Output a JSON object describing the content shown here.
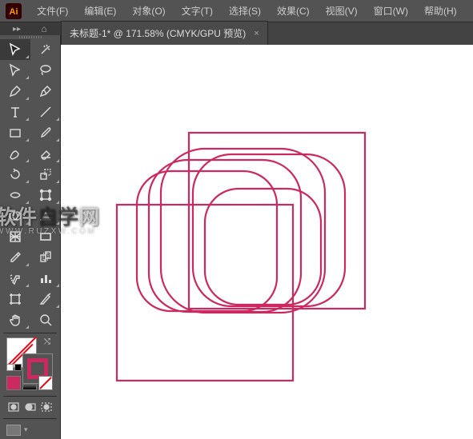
{
  "app": {
    "name": "Adobe Illustrator",
    "logo_bg": "#330000",
    "logo_fg": "#ff9a00"
  },
  "menu": [
    {
      "label": "文件(F)"
    },
    {
      "label": "编辑(E)"
    },
    {
      "label": "对象(O)"
    },
    {
      "label": "文字(T)"
    },
    {
      "label": "选择(S)"
    },
    {
      "label": "效果(C)"
    },
    {
      "label": "视图(V)"
    },
    {
      "label": "窗口(W)"
    },
    {
      "label": "帮助(H)"
    }
  ],
  "document": {
    "tab_label": "未标题-1* @ 171.58% (CMYK/GPU 预览)",
    "zoom": "171.58%",
    "mode": "CMYK/GPU 预览"
  },
  "colors": {
    "artwork_stroke": "#cb2960",
    "fill": "none",
    "stroke": "#cb2960"
  },
  "swatches": {
    "modes": [
      "#cb2960",
      "#888888",
      "#ffffff"
    ]
  },
  "watermark": {
    "main_a": "软件",
    "main_b": "自学",
    "main_c": "网",
    "sub": "WWW.RUZXW.COM"
  }
}
